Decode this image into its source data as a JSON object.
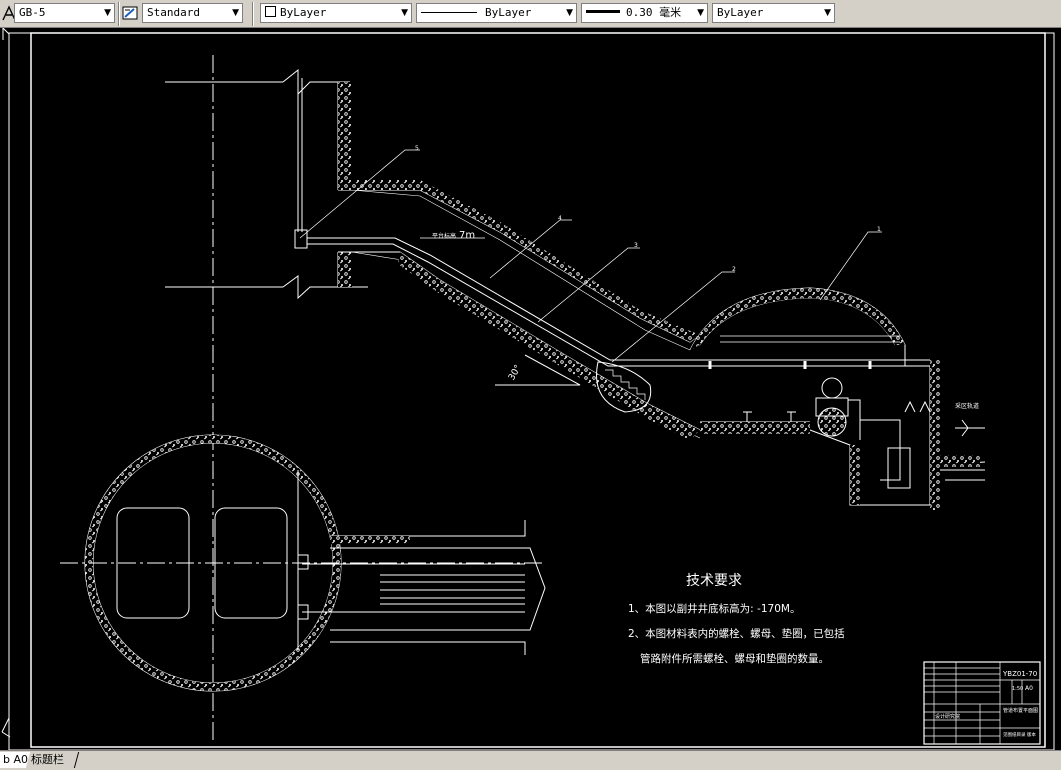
{
  "toolbar": {
    "textstyle": {
      "value": "GB-5",
      "icon": "text-style-icon"
    },
    "dimstyle": {
      "value": "Standard",
      "icon": "dim-style-icon"
    },
    "color": {
      "value": "ByLayer"
    },
    "linetype": {
      "value": "ByLayer"
    },
    "lineweight": {
      "value": "0.30 毫米"
    },
    "plotstyle": {
      "value": "ByLayer"
    }
  },
  "drawing": {
    "notes_title": "技术要求",
    "note1": "1、本图以副井井底标高为: -170M。",
    "note2": "2、本图材料表内的螺栓、螺母、垫圈，已包括",
    "note3": "管路附件所需螺栓、螺母和垫圈的数量。",
    "slope_label": "平台标高",
    "slope_value": "7m",
    "angle_label": "30°",
    "side_label": "采区轨道",
    "callouts": [
      "5",
      "4",
      "3",
      "2",
      "1"
    ],
    "title_block": {
      "code": "YBZ01-70",
      "size": "A0",
      "drawing_name": "管道布置平面图",
      "scale": "1:50",
      "company": "设计研究院",
      "note": "见图纸目录 版本"
    }
  },
  "tabs": {
    "active": "b A0",
    "second": "标题栏"
  },
  "colors": {
    "background": "#000000",
    "lines": "#ffffff",
    "ui": "#d4d0c8"
  }
}
